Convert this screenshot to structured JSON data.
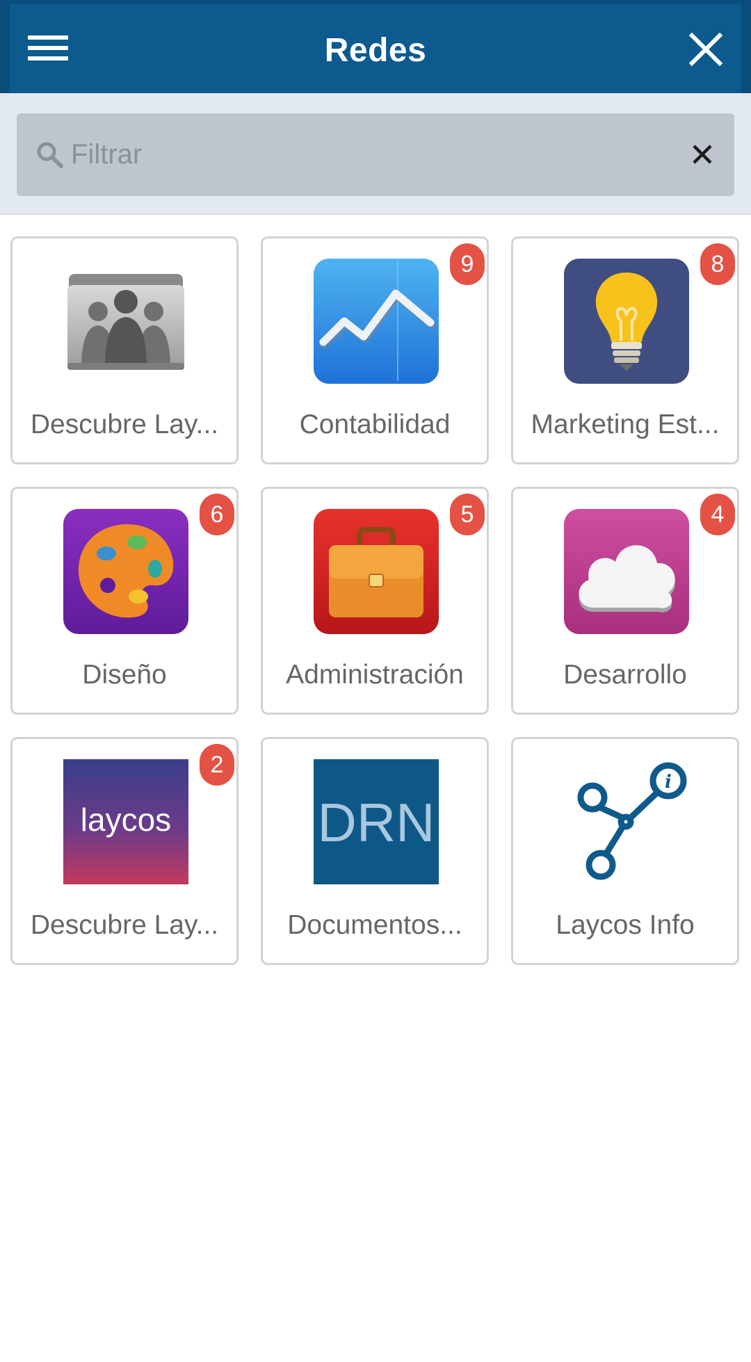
{
  "header": {
    "title": "Redes"
  },
  "search": {
    "placeholder": "Filtrar"
  },
  "tiles": [
    {
      "label": "Descubre Lay...",
      "badge": "",
      "icon": "group-folder-icon"
    },
    {
      "label": "Contabilidad",
      "badge": "9",
      "icon": "chart-line-icon"
    },
    {
      "label": "Marketing Est...",
      "badge": "8",
      "icon": "lightbulb-icon"
    },
    {
      "label": "Diseño",
      "badge": "6",
      "icon": "palette-icon"
    },
    {
      "label": "Administración",
      "badge": "5",
      "icon": "briefcase-icon"
    },
    {
      "label": "Desarrollo",
      "badge": "4",
      "icon": "cloud-icon"
    },
    {
      "label": "Descubre Lay...",
      "badge": "2",
      "icon": "laycos-logo-icon",
      "logo_text": "laycos"
    },
    {
      "label": "Documentos...",
      "badge": "",
      "icon": "drn-logo-icon",
      "logo_text": "DRN"
    },
    {
      "label": "Laycos Info",
      "badge": "",
      "icon": "network-info-icon"
    }
  ],
  "colors": {
    "appbar": "#0c5a8e",
    "badge": "#e35245"
  }
}
